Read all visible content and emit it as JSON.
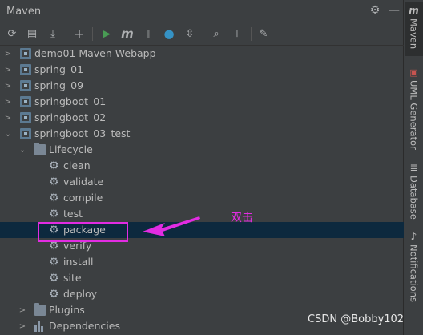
{
  "panel": {
    "title": "Maven",
    "settings_icon": "gear-icon",
    "hide_icon": "minimize-icon"
  },
  "toolbar": {
    "items": [
      {
        "name": "reload-icon",
        "glyph": "⟳"
      },
      {
        "name": "generate-sources-icon",
        "glyph": "▤"
      },
      {
        "name": "download-icon",
        "glyph": "⤓"
      },
      {
        "name": "add-icon",
        "glyph": "+"
      },
      {
        "name": "run-icon",
        "glyph": "▶"
      },
      {
        "name": "execute-goal-icon",
        "glyph": "m"
      },
      {
        "name": "toggle-offline-icon",
        "glyph": "⫲"
      },
      {
        "name": "skip-tests-icon",
        "glyph": "●"
      },
      {
        "name": "collapse-icon",
        "glyph": "⇳"
      },
      {
        "name": "show-dependencies-icon",
        "glyph": "⌕"
      },
      {
        "name": "expand-icon",
        "glyph": "⊤"
      },
      {
        "name": "wrench-icon",
        "glyph": "🔧"
      }
    ]
  },
  "tree": {
    "projects": [
      {
        "label": "demo01 Maven Webapp"
      },
      {
        "label": "spring_01"
      },
      {
        "label": "spring_09"
      },
      {
        "label": "springboot_01"
      },
      {
        "label": "springboot_02"
      },
      {
        "label": "springboot_03_test"
      }
    ],
    "lifecycle_label": "Lifecycle",
    "phases": [
      "clean",
      "validate",
      "compile",
      "test",
      "package",
      "verify",
      "install",
      "site",
      "deploy"
    ],
    "selected_phase": "package",
    "plugins_label": "Plugins",
    "dependencies_label": "Dependencies"
  },
  "annotation": {
    "text": "双击",
    "color": "#e22ce2"
  },
  "sidebar": {
    "tabs": [
      {
        "label": "Maven",
        "icon": "maven-icon",
        "active": true
      },
      {
        "label": "UML Generator",
        "icon": "uml-icon",
        "active": false
      },
      {
        "label": "Database",
        "icon": "database-icon",
        "active": false
      },
      {
        "label": "Notifications",
        "icon": "bell-icon",
        "active": false
      }
    ]
  },
  "watermark": "CSDN @Bobby102",
  "colors": {
    "background": "#3c3f41",
    "selection": "#0d293e",
    "text": "#bbbbbb",
    "run_green": "#499c54",
    "skip_blue": "#3592c4"
  }
}
